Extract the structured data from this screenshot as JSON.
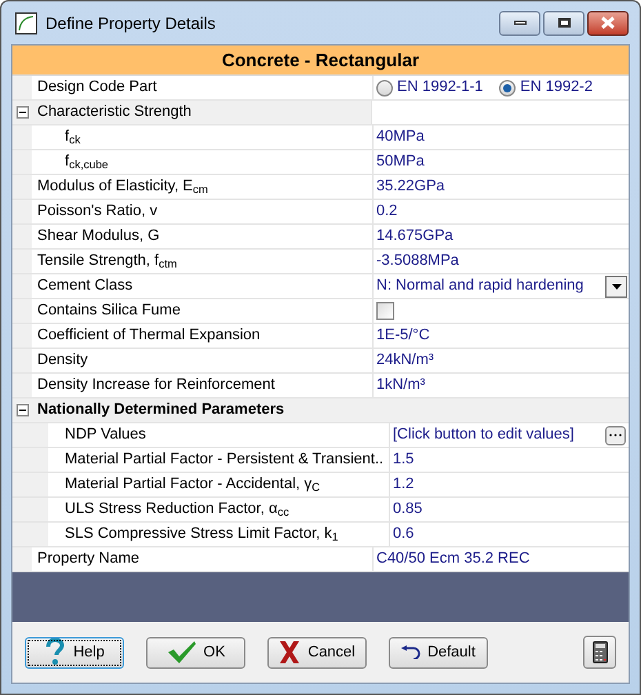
{
  "window": {
    "title": "Define Property Details"
  },
  "header": "Concrete - Rectangular",
  "rows": [
    {
      "kind": "radio",
      "label": "Design Code Part",
      "options": [
        {
          "label": "EN 1992-1-1",
          "selected": false
        },
        {
          "label": "EN 1992-2",
          "selected": true
        }
      ]
    },
    {
      "kind": "group",
      "label": "Characteristic Strength",
      "bold": false,
      "expanded": true,
      "children": [
        {
          "kind": "text",
          "label": "f$_{ck}$",
          "value": "40MPa"
        },
        {
          "kind": "text",
          "label": "f$_{ck,cube}$",
          "value": "50MPa"
        }
      ]
    },
    {
      "kind": "text",
      "label": "Modulus of Elasticity, E$_{cm}$",
      "value": "35.22GPa"
    },
    {
      "kind": "text",
      "label": "Poisson's Ratio, v",
      "value": "0.2"
    },
    {
      "kind": "text",
      "label": "Shear Modulus, G",
      "value": "14.675GPa"
    },
    {
      "kind": "text",
      "label": "Tensile Strength, f$_{ctm}$",
      "value": "-3.5088MPa"
    },
    {
      "kind": "dropdown",
      "label": "Cement Class",
      "value": "N: Normal and rapid hardening"
    },
    {
      "kind": "checkbox",
      "label": "Contains Silica Fume",
      "checked": false
    },
    {
      "kind": "text",
      "label": "Coefficient of Thermal Expansion",
      "value": "1E-5/°C"
    },
    {
      "kind": "text",
      "label": "Density",
      "value": "24kN/m³"
    },
    {
      "kind": "text",
      "label": "Density Increase for Reinforcement",
      "value": "1kN/m³"
    },
    {
      "kind": "group",
      "label": "Nationally Determined Parameters",
      "bold": true,
      "expanded": true,
      "children": [
        {
          "kind": "button",
          "label": "NDP Values",
          "value": "[Click button to edit values]"
        },
        {
          "kind": "text",
          "label": "Material Partial Factor - Persistent & Transient..",
          "value": "1.5"
        },
        {
          "kind": "text",
          "label": "Material Partial Factor - Accidental, γ$_{C}$",
          "value": "1.2"
        },
        {
          "kind": "text",
          "label": "ULS Stress Reduction Factor, α$_{cc}$",
          "value": "0.85"
        },
        {
          "kind": "text",
          "label": "SLS Compressive Stress Limit Factor, k$_{1}$",
          "value": "0.6"
        }
      ]
    },
    {
      "kind": "text",
      "label": "Property Name",
      "value": "C40/50 Ecm 35.2 REC"
    }
  ],
  "buttons": [
    {
      "kind": "help",
      "label": "Help",
      "focused": true
    },
    {
      "kind": "ok",
      "label": "OK",
      "focused": false
    },
    {
      "kind": "cancel",
      "label": "Cancel",
      "focused": false
    },
    {
      "kind": "default",
      "label": "Default",
      "focused": false
    }
  ]
}
